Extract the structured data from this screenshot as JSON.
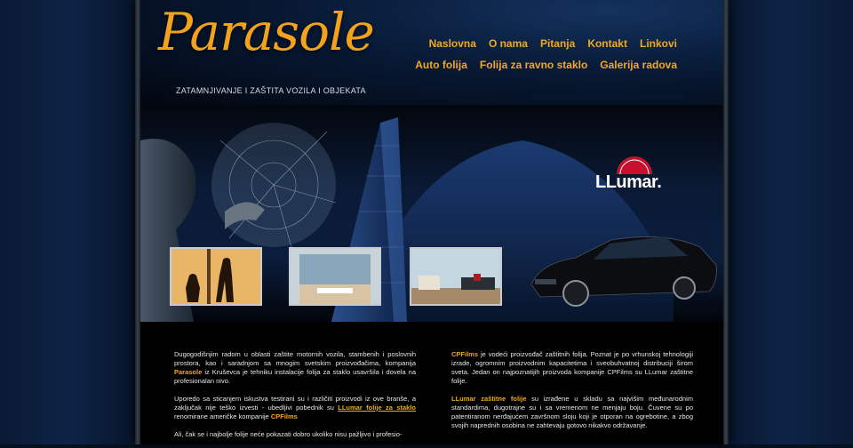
{
  "site": {
    "logo_text": "Parasole",
    "tagline": "ZATAMNJIVANJE I ZAŠTITA VOZILA I OBJEKATA"
  },
  "nav": {
    "row1": [
      "Naslovna",
      "O nama",
      "Pitanja",
      "Kontakt",
      "Linkovi"
    ],
    "row2": [
      "Auto folija",
      "Folija za ravno staklo",
      "Galerija radova"
    ]
  },
  "banner": {
    "brand": "LLumar."
  },
  "content": {
    "left": {
      "p1_a": "Dugogodišnjim radom u oblasti zaštite motornih vozila, stambenih i poslovnih prostora, kao i saradnjom sa mnogim svetskim proizvođačima, kompanija ",
      "p1_brand": "Parasole",
      "p1_b": " iz Kruševca je tehniku instalacije folija za staklo usavršila i dovela na profesionalan nivo.",
      "p2_a": "Uporedo sa sticanjem iskustva testirani su i različiti proizvodi iz ove branše, a zaključak nije teško izvesti - ubedljivi pobednik su ",
      "p2_link": "LLumar folije za staklo",
      "p2_b": " renomirane američke kompanije ",
      "p2_brand": "CPFilms",
      "p3": "Ali, čak se i najbolje folije neće pokazati dobro ukoliko nisu pažljivo i profesio-"
    },
    "right": {
      "p1_brand": "CPFilms",
      "p1_text": " je vodeći proizvođač zaštitnih folija. Poznat je po vrhunskoj tehnologiji izrade, ogromnim proizvodnim kapacitetima i sveobuhvatnoj distribuciji širom sveta. Jedan on najpoznatijih proizvoda kompanije CPFilms su LLumar zaštitne folije.",
      "p2_brand": "LLumar zaštitne folije",
      "p2_text": " su izrađene u skladu sa najvišim međunarodnim standardima, dugotrajne su i sa vremenom ne menjaju boju. Čuvene su po patentiranom nerđajućem završnom sloju koji je otporan na ogrebotine, a zbog svojih naprednih osobina ne zahtevaju gotovo nikakvo održavanje."
    }
  },
  "colors": {
    "accent": "#f0a820",
    "background": "#000000",
    "text": "#e8e8e8"
  }
}
